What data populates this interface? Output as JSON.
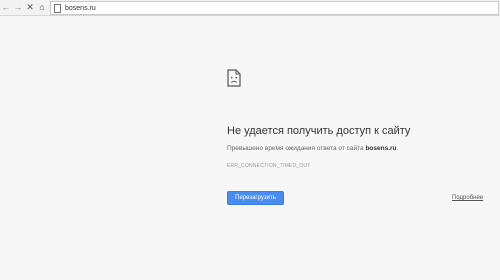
{
  "browser": {
    "back_icon": "←",
    "forward_icon": "→",
    "stop_icon": "✕",
    "home_icon": "⌂",
    "url": "bosens.ru"
  },
  "error": {
    "title": "Не удается получить доступ к сайту",
    "message_prefix": "Превышено время ожидания ответа от сайта ",
    "message_host": "bosens.ru",
    "message_suffix": ".",
    "code": "ERR_CONNECTION_TIMED_OUT",
    "reload_label": "Перезагрузить",
    "details_label": "Подробнее"
  },
  "colors": {
    "accent": "#4a8df0",
    "background": "#f7f7f7"
  }
}
